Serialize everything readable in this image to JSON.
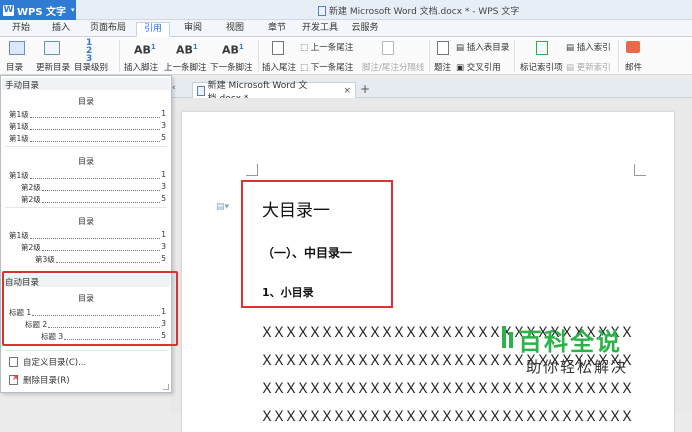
{
  "app": {
    "name": "WPS 文字",
    "window_title": "新建 Microsoft Word 文档.docx * - WPS 文字"
  },
  "menu": {
    "tabs": [
      "开始",
      "插入",
      "页面布局",
      "引用",
      "审阅",
      "视图",
      "章节",
      "开发工具",
      "云服务"
    ],
    "active": "引用"
  },
  "ribbon": {
    "toc": "目录",
    "update_toc": "更新目录",
    "toc_level": "目录级别",
    "insert_footnote": "插入脚注",
    "prev_footnote": "上一条脚注",
    "next_footnote": "下一条脚注",
    "insert_endnote": "插入尾注",
    "prev_endnote": "上一条尾注",
    "next_endnote": "下一条尾注",
    "footnote_separator": "脚注/尾注分隔线",
    "caption": "题注",
    "insert_table_of_figures": "插入表目录",
    "cross_reference": "交叉引用",
    "mark_index": "标记索引项",
    "insert_index": "插入索引",
    "update_index": "更新索引",
    "mail": "邮件",
    "ab_labels": [
      "AB",
      "AB",
      "AB"
    ],
    "ab_sups": [
      "1",
      "1",
      "1"
    ]
  },
  "doc_tab": {
    "name": "新建 Microsoft Word 文档.docx *",
    "close": "×",
    "new": "+"
  },
  "dropdown": {
    "manual_header": "手动目录",
    "auto_header": "自动目录",
    "toc_title": "目录",
    "manual_groups": [
      [
        {
          "text": "第1级",
          "page": "1"
        },
        {
          "text": "第1级",
          "page": "3"
        },
        {
          "text": "第1级",
          "page": "5"
        }
      ],
      [
        {
          "text": "第1级",
          "page": "1"
        },
        {
          "text": "第2级",
          "page": "3"
        },
        {
          "text": "第2级",
          "page": "5"
        }
      ],
      [
        {
          "text": "第1级",
          "page": "1"
        },
        {
          "text": "第2级",
          "page": "3"
        },
        {
          "text": "第3级",
          "page": "5"
        }
      ]
    ],
    "auto_group": [
      {
        "text": "标题 1",
        "page": "1"
      },
      {
        "text": "标题 2",
        "page": "3"
      },
      {
        "text": "标题 3",
        "page": "5"
      }
    ],
    "custom_toc": "自定义目录(C)...",
    "delete_toc": "删除目录(R)"
  },
  "document": {
    "h1": "大目录一",
    "h2": "（一）、中目录一",
    "h3": "1、小目录",
    "filler_line": "ＸＸＸＸＸＸＸＸＸＸＸＸＸＸＸＸＸＸＸＸＸＸＸＸＸＸＸＸＸＸＸＸＸ"
  },
  "watermark": {
    "title": "百科全说",
    "subtitle": "助你轻松解决"
  }
}
